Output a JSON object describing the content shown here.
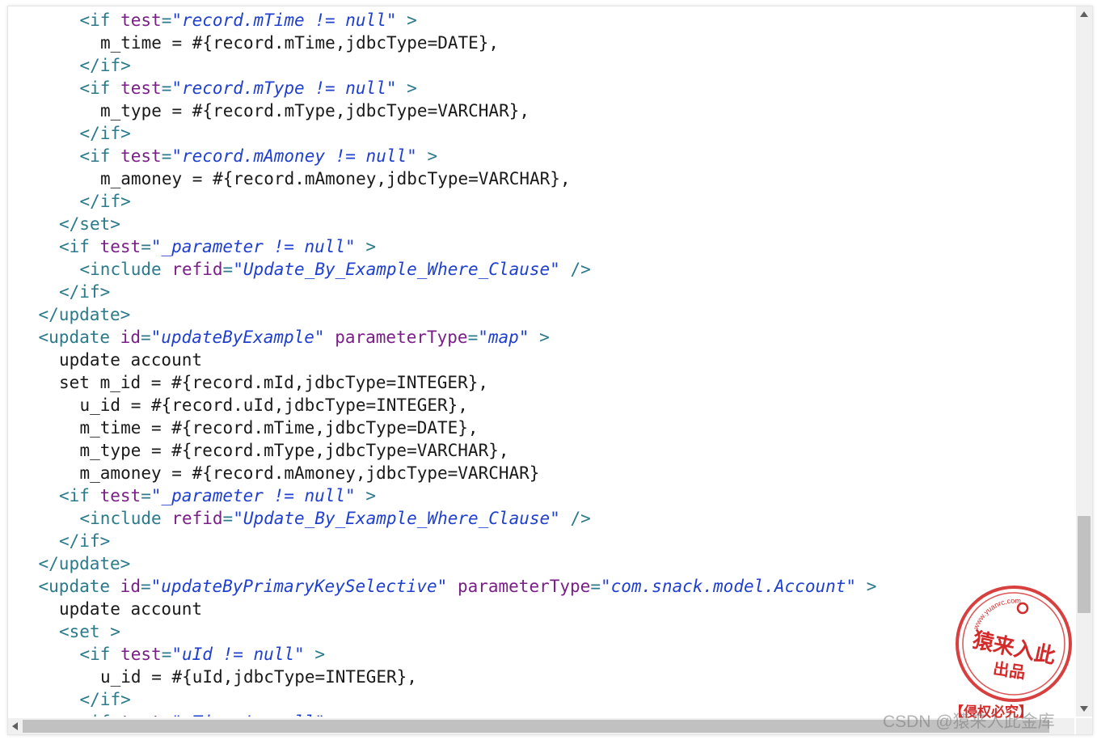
{
  "code_lines": [
    {
      "indent": 6,
      "tokens": [
        [
          "punct",
          "<"
        ],
        [
          "tag",
          "if"
        ],
        [
          "text",
          " "
        ],
        [
          "attr",
          "test"
        ],
        [
          "punct",
          "="
        ],
        [
          "str",
          "\"record.mTime != null\""
        ],
        [
          "text",
          " "
        ],
        [
          "punct",
          ">"
        ]
      ]
    },
    {
      "indent": 8,
      "tokens": [
        [
          "text",
          "m_time = #{record.mTime,jdbcType=DATE},"
        ]
      ]
    },
    {
      "indent": 6,
      "tokens": [
        [
          "punct",
          "</"
        ],
        [
          "tag",
          "if"
        ],
        [
          "punct",
          ">"
        ]
      ]
    },
    {
      "indent": 6,
      "tokens": [
        [
          "punct",
          "<"
        ],
        [
          "tag",
          "if"
        ],
        [
          "text",
          " "
        ],
        [
          "attr",
          "test"
        ],
        [
          "punct",
          "="
        ],
        [
          "str",
          "\"record.mType != null\""
        ],
        [
          "text",
          " "
        ],
        [
          "punct",
          ">"
        ]
      ]
    },
    {
      "indent": 8,
      "tokens": [
        [
          "text",
          "m_type = #{record.mType,jdbcType=VARCHAR},"
        ]
      ]
    },
    {
      "indent": 6,
      "tokens": [
        [
          "punct",
          "</"
        ],
        [
          "tag",
          "if"
        ],
        [
          "punct",
          ">"
        ]
      ]
    },
    {
      "indent": 6,
      "tokens": [
        [
          "punct",
          "<"
        ],
        [
          "tag",
          "if"
        ],
        [
          "text",
          " "
        ],
        [
          "attr",
          "test"
        ],
        [
          "punct",
          "="
        ],
        [
          "str",
          "\"record.mAmoney != null\""
        ],
        [
          "text",
          " "
        ],
        [
          "punct",
          ">"
        ]
      ]
    },
    {
      "indent": 8,
      "tokens": [
        [
          "text",
          "m_amoney = #{record.mAmoney,jdbcType=VARCHAR},"
        ]
      ]
    },
    {
      "indent": 6,
      "tokens": [
        [
          "punct",
          "</"
        ],
        [
          "tag",
          "if"
        ],
        [
          "punct",
          ">"
        ]
      ]
    },
    {
      "indent": 4,
      "tokens": [
        [
          "punct",
          "</"
        ],
        [
          "tag",
          "set"
        ],
        [
          "punct",
          ">"
        ]
      ]
    },
    {
      "indent": 4,
      "tokens": [
        [
          "punct",
          "<"
        ],
        [
          "tag",
          "if"
        ],
        [
          "text",
          " "
        ],
        [
          "attr",
          "test"
        ],
        [
          "punct",
          "="
        ],
        [
          "str",
          "\"_parameter != null\""
        ],
        [
          "text",
          " "
        ],
        [
          "punct",
          ">"
        ]
      ]
    },
    {
      "indent": 6,
      "tokens": [
        [
          "punct",
          "<"
        ],
        [
          "tag",
          "include"
        ],
        [
          "text",
          " "
        ],
        [
          "attr",
          "refid"
        ],
        [
          "punct",
          "="
        ],
        [
          "str",
          "\"Update_By_Example_Where_Clause\""
        ],
        [
          "text",
          " "
        ],
        [
          "punct",
          "/>"
        ]
      ]
    },
    {
      "indent": 4,
      "tokens": [
        [
          "punct",
          "</"
        ],
        [
          "tag",
          "if"
        ],
        [
          "punct",
          ">"
        ]
      ]
    },
    {
      "indent": 2,
      "tokens": [
        [
          "punct",
          "</"
        ],
        [
          "tag",
          "update"
        ],
        [
          "punct",
          ">"
        ]
      ]
    },
    {
      "indent": 2,
      "tokens": [
        [
          "punct",
          "<"
        ],
        [
          "tag",
          "update"
        ],
        [
          "text",
          " "
        ],
        [
          "attr",
          "id"
        ],
        [
          "punct",
          "="
        ],
        [
          "str",
          "\"updateByExample\""
        ],
        [
          "text",
          " "
        ],
        [
          "attr",
          "parameterType"
        ],
        [
          "punct",
          "="
        ],
        [
          "str",
          "\"map\""
        ],
        [
          "text",
          " "
        ],
        [
          "punct",
          ">"
        ]
      ]
    },
    {
      "indent": 4,
      "tokens": [
        [
          "text",
          "update account"
        ]
      ]
    },
    {
      "indent": 4,
      "tokens": [
        [
          "text",
          "set m_id = #{record.mId,jdbcType=INTEGER},"
        ]
      ]
    },
    {
      "indent": 6,
      "tokens": [
        [
          "text",
          "u_id = #{record.uId,jdbcType=INTEGER},"
        ]
      ]
    },
    {
      "indent": 6,
      "tokens": [
        [
          "text",
          "m_time = #{record.mTime,jdbcType=DATE},"
        ]
      ]
    },
    {
      "indent": 6,
      "tokens": [
        [
          "text",
          "m_type = #{record.mType,jdbcType=VARCHAR},"
        ]
      ]
    },
    {
      "indent": 6,
      "tokens": [
        [
          "text",
          "m_amoney = #{record.mAmoney,jdbcType=VARCHAR}"
        ]
      ]
    },
    {
      "indent": 4,
      "tokens": [
        [
          "punct",
          "<"
        ],
        [
          "tag",
          "if"
        ],
        [
          "text",
          " "
        ],
        [
          "attr",
          "test"
        ],
        [
          "punct",
          "="
        ],
        [
          "str",
          "\"_parameter != null\""
        ],
        [
          "text",
          " "
        ],
        [
          "punct",
          ">"
        ]
      ]
    },
    {
      "indent": 6,
      "tokens": [
        [
          "punct",
          "<"
        ],
        [
          "tag",
          "include"
        ],
        [
          "text",
          " "
        ],
        [
          "attr",
          "refid"
        ],
        [
          "punct",
          "="
        ],
        [
          "str",
          "\"Update_By_Example_Where_Clause\""
        ],
        [
          "text",
          " "
        ],
        [
          "punct",
          "/>"
        ]
      ]
    },
    {
      "indent": 4,
      "tokens": [
        [
          "punct",
          "</"
        ],
        [
          "tag",
          "if"
        ],
        [
          "punct",
          ">"
        ]
      ]
    },
    {
      "indent": 2,
      "tokens": [
        [
          "punct",
          "</"
        ],
        [
          "tag",
          "update"
        ],
        [
          "punct",
          ">"
        ]
      ]
    },
    {
      "indent": 2,
      "tokens": [
        [
          "punct",
          "<"
        ],
        [
          "tag",
          "update"
        ],
        [
          "text",
          " "
        ],
        [
          "attr",
          "id"
        ],
        [
          "punct",
          "="
        ],
        [
          "str",
          "\"updateByPrimaryKeySelective\""
        ],
        [
          "text",
          " "
        ],
        [
          "attr",
          "parameterType"
        ],
        [
          "punct",
          "="
        ],
        [
          "str",
          "\"com.snack.model.Account\""
        ],
        [
          "text",
          " "
        ],
        [
          "punct",
          ">"
        ]
      ]
    },
    {
      "indent": 4,
      "tokens": [
        [
          "text",
          "update account"
        ]
      ]
    },
    {
      "indent": 4,
      "tokens": [
        [
          "punct",
          "<"
        ],
        [
          "tag",
          "set"
        ],
        [
          "text",
          " "
        ],
        [
          "punct",
          ">"
        ]
      ]
    },
    {
      "indent": 6,
      "tokens": [
        [
          "punct",
          "<"
        ],
        [
          "tag",
          "if"
        ],
        [
          "text",
          " "
        ],
        [
          "attr",
          "test"
        ],
        [
          "punct",
          "="
        ],
        [
          "str",
          "\"uId != null\""
        ],
        [
          "text",
          " "
        ],
        [
          "punct",
          ">"
        ]
      ]
    },
    {
      "indent": 8,
      "tokens": [
        [
          "text",
          "u_id = #{uId,jdbcType=INTEGER},"
        ]
      ]
    },
    {
      "indent": 6,
      "tokens": [
        [
          "punct",
          "</"
        ],
        [
          "tag",
          "if"
        ],
        [
          "punct",
          ">"
        ]
      ]
    },
    {
      "indent": 6,
      "tokens": [
        [
          "punct",
          "<"
        ],
        [
          "tag",
          "if"
        ],
        [
          "text",
          " "
        ],
        [
          "attr",
          "test"
        ],
        [
          "punct",
          "="
        ],
        [
          "str",
          "\"mTime != null\""
        ],
        [
          "text",
          " "
        ],
        [
          "punct",
          ">"
        ]
      ]
    }
  ],
  "stamp": {
    "url_text": "www.yuanrc.com",
    "main_text": "猿来入此",
    "sub_text": "出品",
    "caption": "【侵权必究】"
  },
  "watermark": "CSDN @猿来入此金库",
  "colors": {
    "punct": "#2b7a8c",
    "tag": "#2b7a8c",
    "attr": "#7a1f87",
    "string": "#1f3fcf",
    "text": "#1a1a1a",
    "stamp": "#d42a2a"
  }
}
